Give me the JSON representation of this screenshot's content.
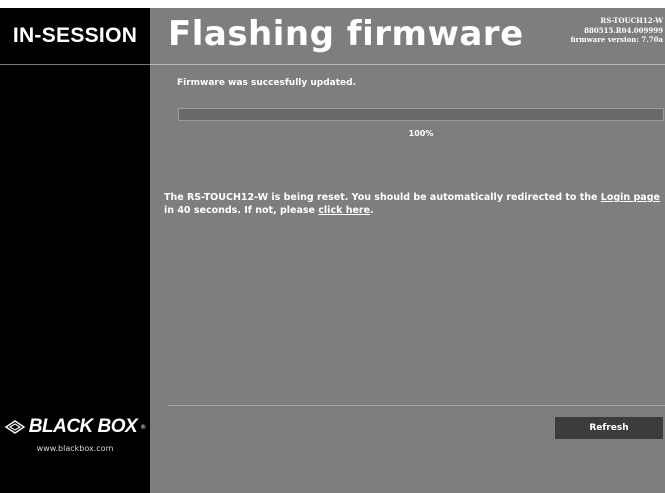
{
  "sidebar": {
    "brand": "IN-SESSION",
    "logo_text": "BLACK BOX",
    "logo_registered": "®",
    "logo_url": "www.blackbox.com"
  },
  "header": {
    "title": "Flashing firmware",
    "device_model": "RS-TOUCH12-W",
    "device_serial": "880515.R04.009999",
    "firmware_version": "firmware version: 7.70a"
  },
  "main": {
    "status_message": "Firmware was succesfully updated.",
    "progress_fraction": 1.0,
    "progress_label": "100%",
    "reset_message_part1": "The RS-TOUCH12-W is being reset. You should be automatically redirected to the",
    "login_link_text": "Login page",
    "reset_message_part2": "in 40 seconds. If not, please",
    "click_here_text": "click here",
    "reset_message_part3": ".",
    "refresh_label": "Refresh"
  },
  "colors": {
    "sidebar_bg": "#000000",
    "main_bg": "#7e7e7e",
    "progress_track": "#696969",
    "button_bg": "#3c3c3c",
    "text": "#ffffff"
  },
  "icons": {
    "logo_icon": "diamond-outline-icon"
  }
}
